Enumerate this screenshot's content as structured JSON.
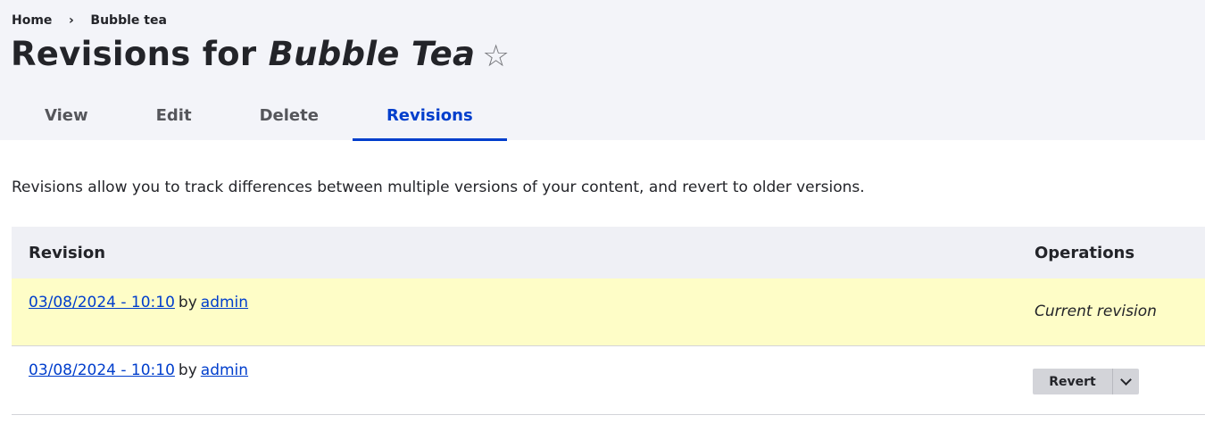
{
  "breadcrumb": {
    "items": [
      "Home",
      "Bubble tea"
    ],
    "separator": "›"
  },
  "title": {
    "prefix": "Revisions for ",
    "node_title": "Bubble Tea",
    "star_icon": "☆"
  },
  "tabs": [
    {
      "label": "View",
      "active": false
    },
    {
      "label": "Edit",
      "active": false
    },
    {
      "label": "Delete",
      "active": false
    },
    {
      "label": "Revisions",
      "active": true
    }
  ],
  "description": "Revisions allow you to track differences between multiple versions of your content, and revert to older versions.",
  "table": {
    "headers": {
      "revision": "Revision",
      "operations": "Operations"
    },
    "rows": [
      {
        "date": "03/08/2024 - 10:10",
        "by": "by",
        "author": "admin",
        "operation": "Current revision",
        "current": true
      },
      {
        "date": "03/08/2024 - 10:10",
        "by": "by",
        "author": "admin",
        "operation": "Revert",
        "current": false
      }
    ]
  },
  "colors": {
    "accent": "#003ecc",
    "current_row_bg": "#fefdc7",
    "header_bg": "#f3f4f9"
  }
}
